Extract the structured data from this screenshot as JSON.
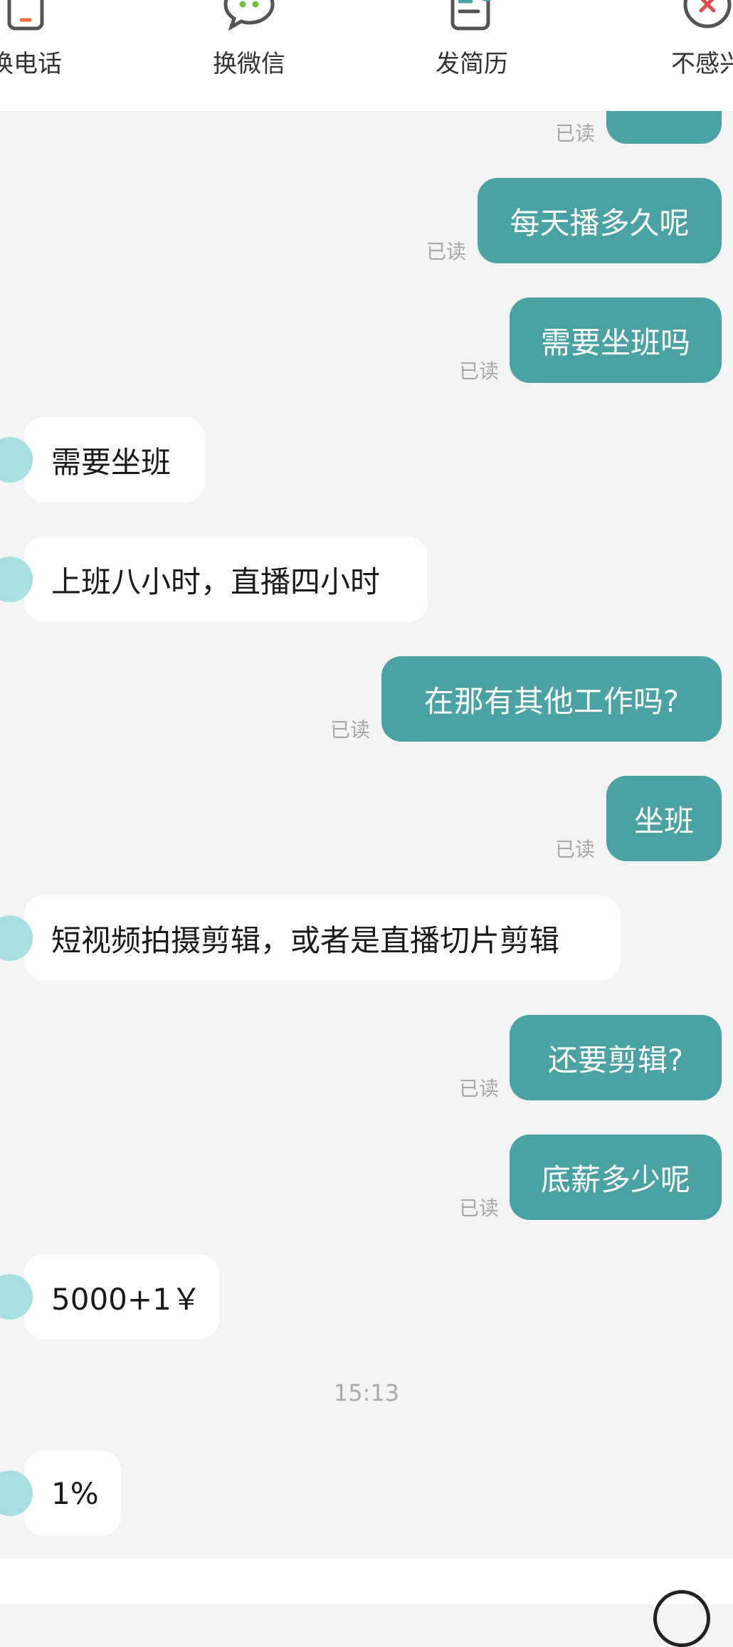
{
  "toolbar": {
    "items": [
      {
        "label": "换电话",
        "icon": "phone-icon"
      },
      {
        "label": "换微信",
        "icon": "wechat-icon"
      },
      {
        "label": "发简历",
        "icon": "resume-icon"
      },
      {
        "label": "不感兴",
        "icon": "close-icon"
      }
    ]
  },
  "messages": {
    "read_label": "已读",
    "m1": "每天播多久呢",
    "m2": "需要坐班吗",
    "m3": "需要坐班",
    "m4": "上班八小时，直播四小时",
    "m5": "在那有其他工作吗?",
    "m6": "坐班",
    "m7": "短视频拍摄剪辑，或者是直播切片剪辑",
    "m8": "还要剪辑?",
    "m9": "底薪多少呢",
    "m10": "5000+1￥",
    "timestamp": "15:13",
    "m11": "1%"
  },
  "colors": {
    "sent_bubble": "#4aa3a2",
    "recv_bubble": "#ffffff",
    "background": "#f4f4f4",
    "avatar": "#a8dfe3"
  }
}
